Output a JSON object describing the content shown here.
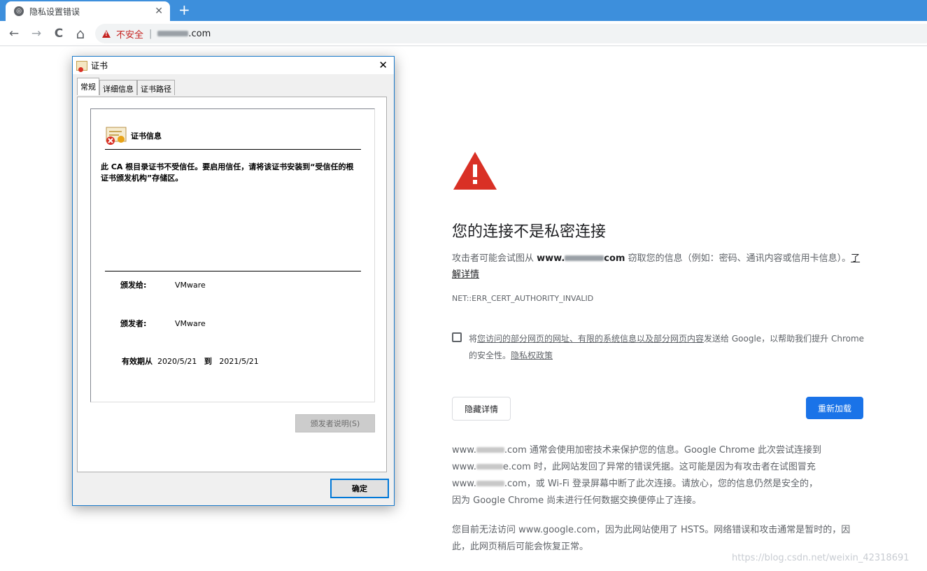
{
  "browser": {
    "tab_title": "隐私设置错误",
    "tab_close": "✕",
    "new_tab": "+",
    "back": "←",
    "forward": "→",
    "reload": "C",
    "home": "⌂",
    "security_label": "不安全",
    "separator": "|",
    "url_suffix": ".com"
  },
  "dialog": {
    "title": "证书",
    "close": "✕",
    "tabs": [
      "常规",
      "详细信息",
      "证书路径"
    ],
    "section_title": "证书信息",
    "message": "此 CA 根目录证书不受信任。要启用信任，请将该证书安装到“受信任的根证书颁发机构”存储区。",
    "issued_to_label": "颁发给:",
    "issued_to_value": "VMware",
    "issued_by_label": "颁发者:",
    "issued_by_value": "VMware",
    "validity_label": "有效期从",
    "valid_from": "2020/5/21",
    "validity_to": "到",
    "valid_to": "2021/5/21",
    "issuer_statement_button": "颁发者说明(S)",
    "ok_button": "确定"
  },
  "interstitial": {
    "heading": "您的连接不是私密连接",
    "desc_prefix": "攻击者可能会试图从 ",
    "desc_host_start": "www.",
    "desc_host_end": "com",
    "desc_suffix": " 窃取您的信息（例如：密码、通讯内容或信用卡信息）。",
    "learn_more": "了解详情",
    "error_code": "NET::ERR_CERT_AUTHORITY_INVALID",
    "optin_text_1": "将",
    "optin_link_1": "您访问的部分网页的网址、有限的系统信息以及部分网页内容",
    "optin_text_2": "发送给 Google，以帮助我们提升 Chrome 的安全性。",
    "optin_link_2": "隐私权政策",
    "hide_details": "隐藏详情",
    "reload": "重新加载",
    "detail_p1_line1_start": "www.",
    "detail_p1_line1_mid": ".com 通常会使用加密技术来保护您的信息。Google Chrome 此次尝试连接到",
    "detail_p1_line2_start": "www.",
    "detail_p1_line2_mid": "e.com 时，此网站发回了异常的错误凭据。这可能是因为有攻击者在试图冒充",
    "detail_p1_line3_start": "www.",
    "detail_p1_line3_mid": ".com，或 Wi-Fi 登录屏幕中断了此次连接。请放心，您的信息仍然是安全的，",
    "detail_p1_line4": "因为 Google Chrome 尚未进行任何数据交换便停止了连接。",
    "detail_p2": "您目前无法访问 www.google.com，因为此网站使用了 HSTS。网络错误和攻击通常是暂时的，因此，此网页稍后可能会恢复正常。"
  },
  "watermark": "https://blog.csdn.net/weixin_42318691",
  "colors": {
    "titlebar": "#3d8fdc",
    "danger": "#d93025",
    "primary": "#1a73e8"
  }
}
